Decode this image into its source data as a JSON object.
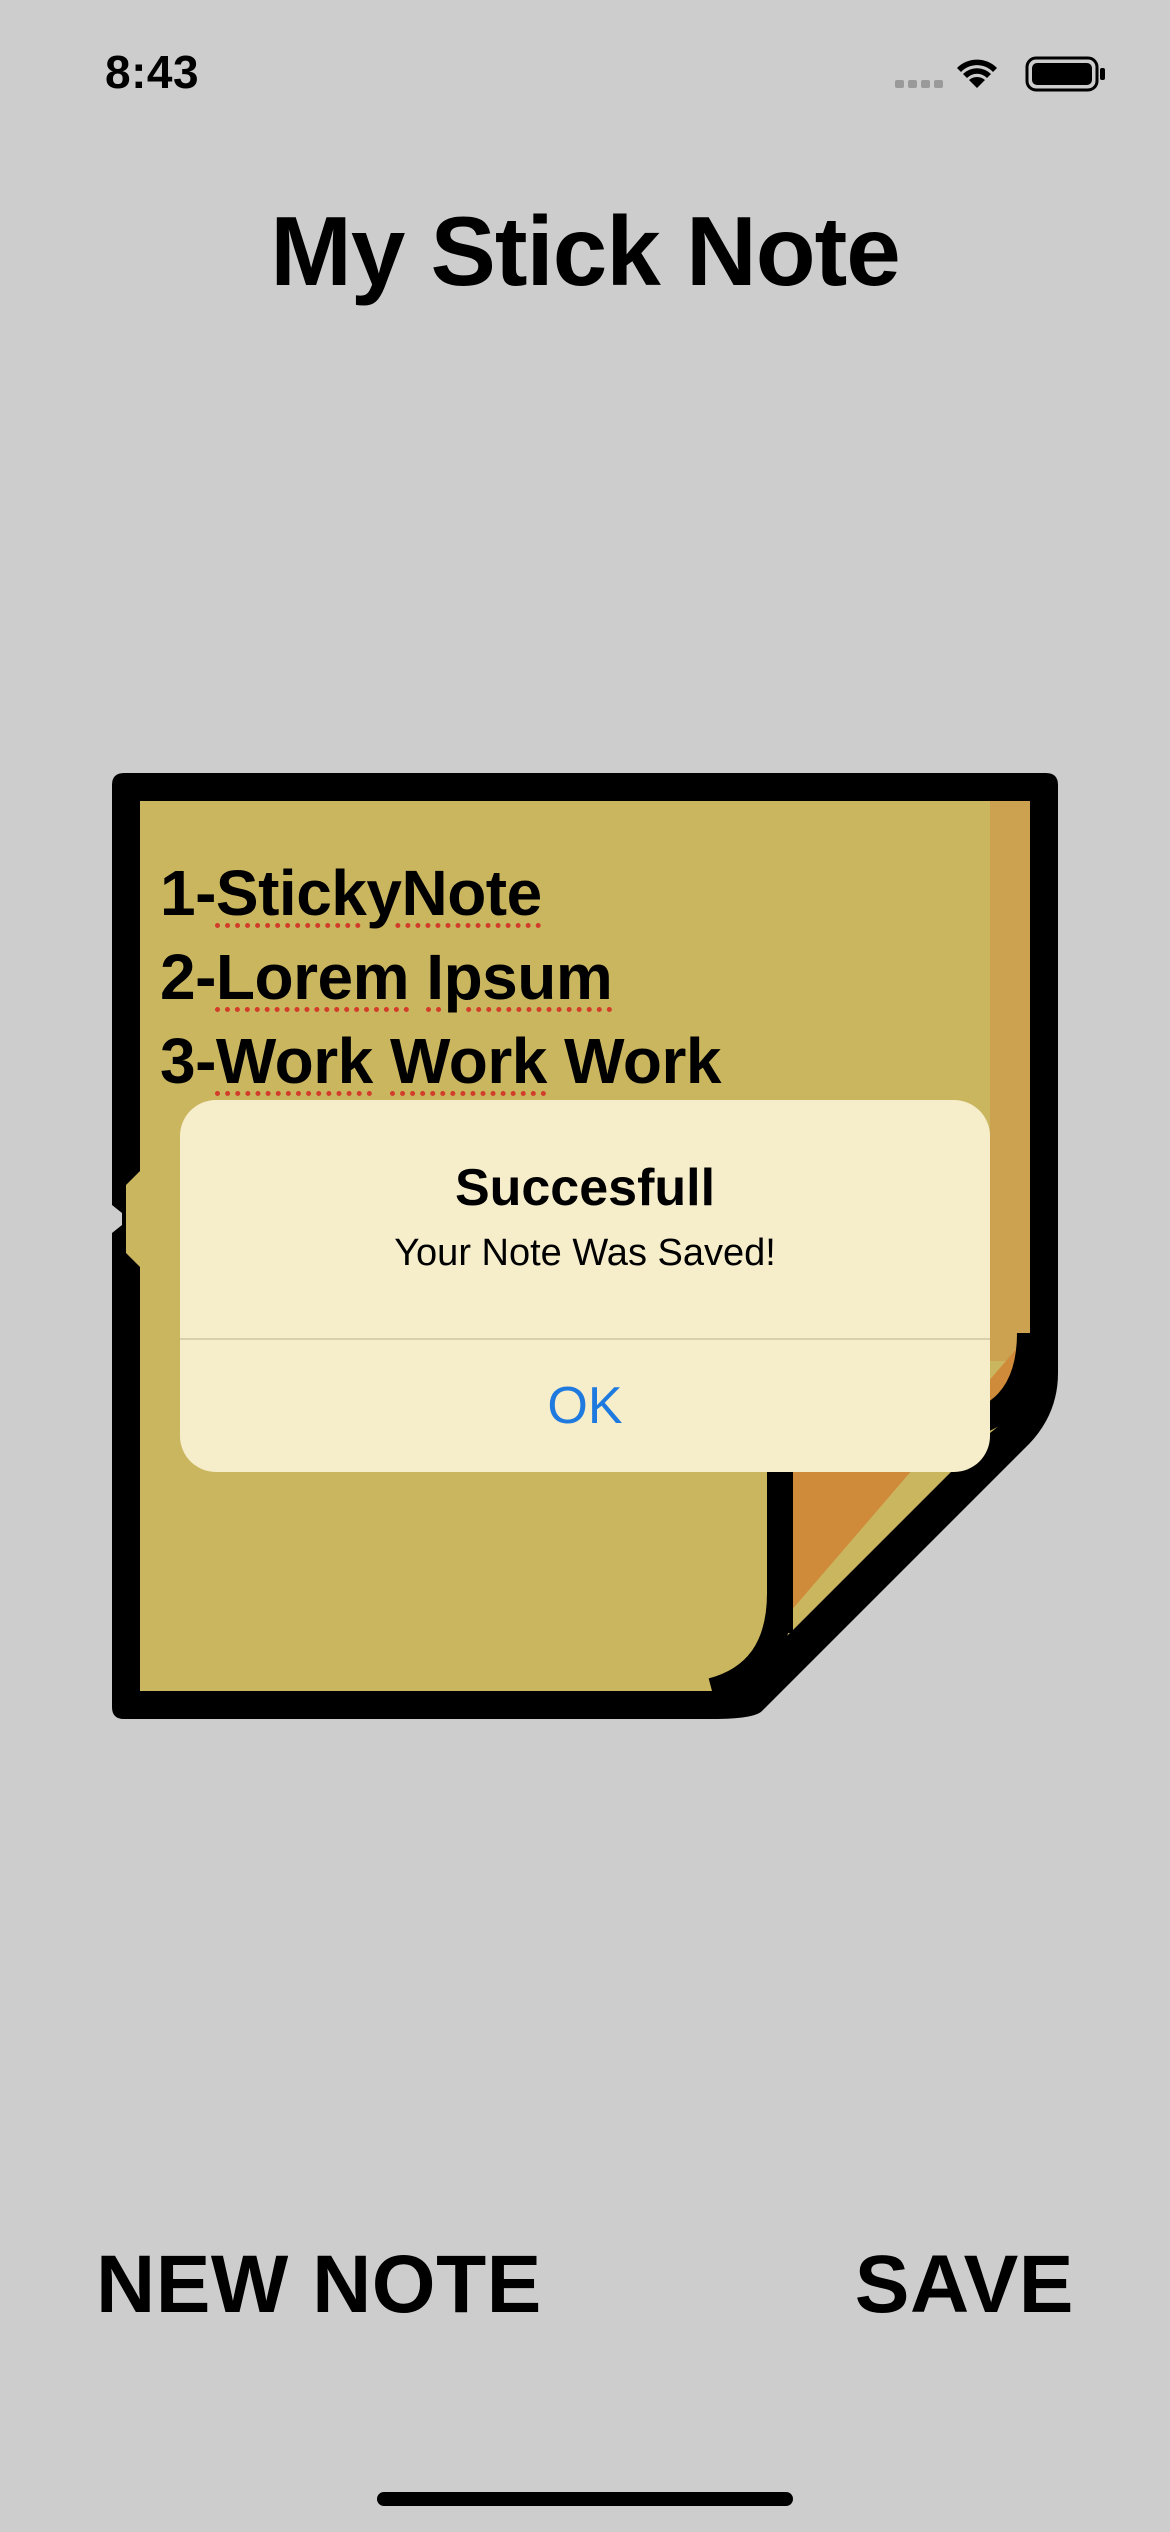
{
  "status_bar": {
    "time": "8:43"
  },
  "page": {
    "title": "My Stick Note"
  },
  "note": {
    "lines": [
      {
        "prefix": "1-",
        "word1": "StickyNote",
        "rest": ""
      },
      {
        "prefix": "2-",
        "word1": "Lorem",
        "mid": " ",
        "word2": "Ipsum"
      },
      {
        "prefix": "3-",
        "word1": "Work",
        "mid": " ",
        "word2": "Work",
        "rest": " Work"
      }
    ],
    "colors": {
      "paper": "#cbb660",
      "flap": "#cf8a3a",
      "border": "#000000"
    }
  },
  "alert": {
    "title": "Succesfull",
    "message": "Your Note Was Saved!",
    "ok_label": "OK"
  },
  "toolbar": {
    "new_note_label": "NEW NOTE",
    "save_label": "SAVE"
  },
  "icons": [
    "signal-icon",
    "wifi-icon",
    "battery-icon"
  ]
}
